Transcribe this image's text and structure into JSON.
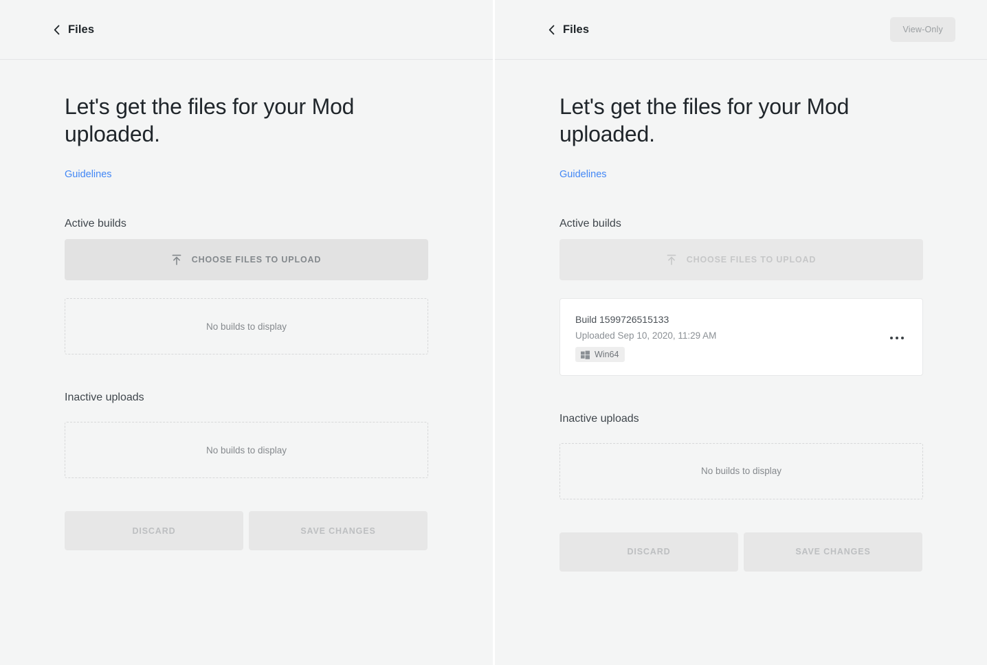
{
  "panels": [
    {
      "id": "editable",
      "header": {
        "back_label": "Files",
        "back_icon": "chevron-left-icon",
        "badge": ""
      },
      "title": "Let's get the files for your Mod uploaded.",
      "guidelines_label": "Guidelines",
      "active_builds": {
        "label": "Active builds",
        "upload_button_label": "CHOOSE FILES TO UPLOAD",
        "upload_icon": "upload-icon",
        "empty_text": "No builds to display"
      },
      "inactive_uploads": {
        "label": "Inactive uploads",
        "empty_text": "No builds to display"
      },
      "actions": {
        "discard_label": "DISCARD",
        "save_label": "SAVE CHANGES"
      }
    },
    {
      "id": "view-only",
      "header": {
        "back_label": "Files",
        "back_icon": "chevron-left-icon",
        "badge": "View-Only"
      },
      "title": "Let's get the files for your Mod uploaded.",
      "guidelines_label": "Guidelines",
      "active_builds": {
        "label": "Active builds",
        "upload_button_label": "CHOOSE FILES TO UPLOAD",
        "upload_icon": "upload-icon",
        "build": {
          "name": "Build 1599726515133",
          "uploaded": "Uploaded Sep 10, 2020, 11:29 AM",
          "platform": "Win64",
          "platform_icon": "windows-icon",
          "menu_icon": "more-horizontal-icon"
        }
      },
      "inactive_uploads": {
        "label": "Inactive uploads",
        "empty_text": "No builds to display"
      },
      "actions": {
        "discard_label": "DISCARD",
        "save_label": "SAVE CHANGES"
      }
    }
  ],
  "colors": {
    "page_background": "#f4f5f5",
    "link": "#4287f5",
    "card_background": "#ffffff",
    "disabled_text": "#bdbfc1"
  }
}
